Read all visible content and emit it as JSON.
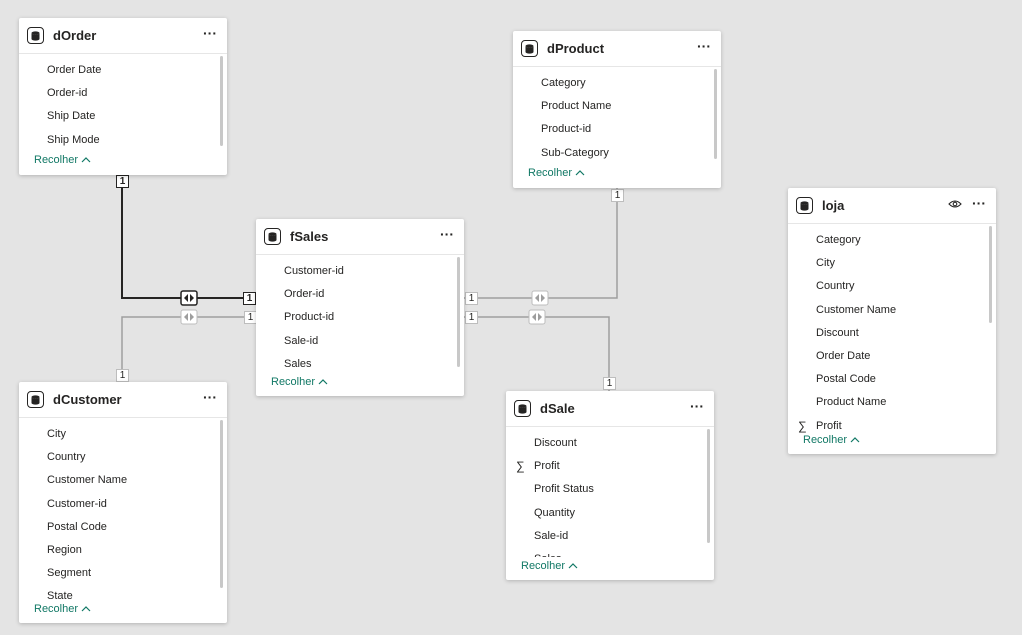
{
  "relationships": {
    "one_label": "1"
  },
  "tables": {
    "dOrder": {
      "title": "dOrder",
      "fields": [
        "Order Date",
        "Order-id",
        "Ship Date",
        "Ship Mode"
      ],
      "collapse_label": "Recolher"
    },
    "dProduct": {
      "title": "dProduct",
      "fields": [
        "Category",
        "Product Name",
        "Product-id",
        "Sub-Category"
      ],
      "collapse_label": "Recolher"
    },
    "fSales": {
      "title": "fSales",
      "fields": [
        "Customer-id",
        "Order-id",
        "Product-id",
        "Sale-id",
        "Sales"
      ],
      "collapse_label": "Recolher"
    },
    "loja": {
      "title": "loja",
      "fields": [
        "Category",
        "City",
        "Country",
        "Customer Name",
        "Discount",
        "Order Date",
        "Postal Code",
        "Product Name",
        "Profit"
      ],
      "collapse_label": "Recolher"
    },
    "dCustomer": {
      "title": "dCustomer",
      "fields": [
        "City",
        "Country",
        "Customer Name",
        "Customer-id",
        "Postal Code",
        "Region",
        "Segment",
        "State"
      ],
      "collapse_label": "Recolher"
    },
    "dSale": {
      "title": "dSale",
      "fields": [
        "Discount",
        "Profit",
        "Profit Status",
        "Quantity",
        "Sale-id",
        "Sales"
      ],
      "collapse_label": "Recolher"
    }
  }
}
